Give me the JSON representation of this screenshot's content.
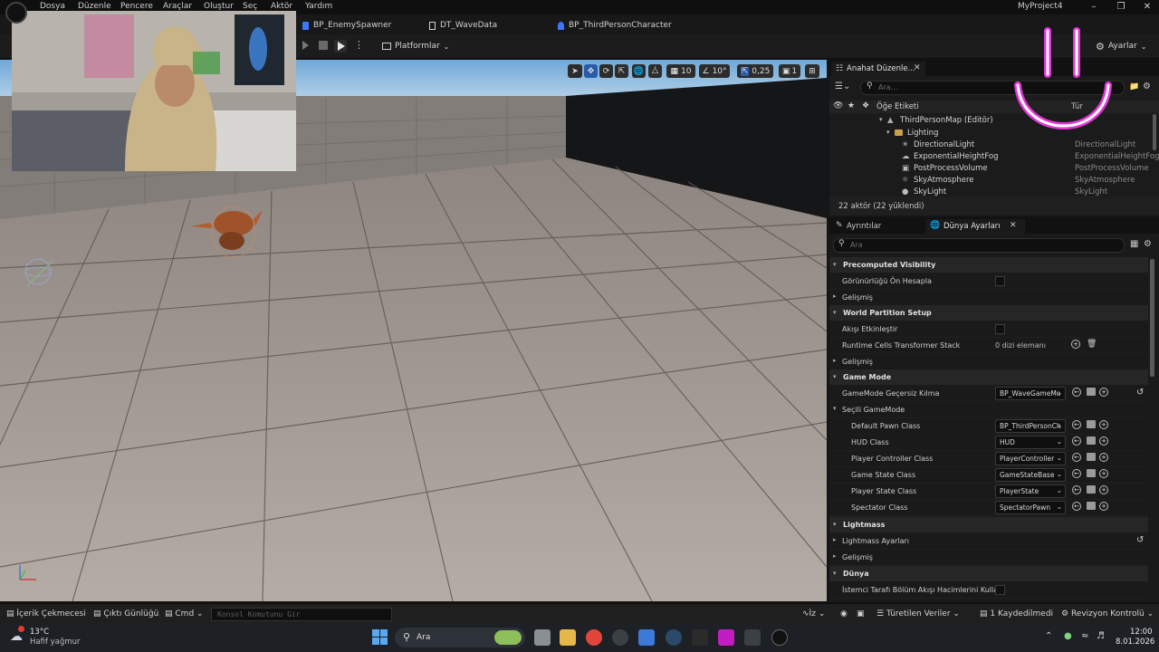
{
  "menu": {
    "items": [
      "Dosya",
      "Düzenle",
      "Pencere",
      "Araçlar",
      "Oluştur",
      "Seç",
      "Aktör",
      "Yardım"
    ],
    "project": "MyProject4"
  },
  "tabs": [
    {
      "label": "BP_EnemySpawner",
      "color": "#3b78ff"
    },
    {
      "label": "DT_WaveData",
      "color": "#d0d0d0"
    },
    {
      "label": "BP_ThirdPersonCharacter",
      "color": "#3b78ff"
    }
  ],
  "toolbar": {
    "platforms": "Platformlar",
    "settings": "Ayarlar"
  },
  "viewport": {
    "grid_snap": "10",
    "rot_snap": "10°",
    "scale_snap": "0,25",
    "camera_speed": "1"
  },
  "outliner": {
    "tab": "Anahat Düzenle...",
    "search_placeholder": "Ara...",
    "col_label": "Öğe Etiketi",
    "col_type": "Tür",
    "map": "ThirdPersonMap (Editör)",
    "folder": "Lighting",
    "items": [
      {
        "name": "DirectionalLight",
        "type": "DirectionalLight"
      },
      {
        "name": "ExponentialHeightFog",
        "type": "ExponentialHeightFog"
      },
      {
        "name": "PostProcessVolume",
        "type": "PostProcessVolume"
      },
      {
        "name": "SkyAtmosphere",
        "type": "SkyAtmosphere"
      },
      {
        "name": "SkyLight",
        "type": "SkyLight"
      }
    ],
    "status": "22 aktör (22 yüklendi)"
  },
  "details": {
    "tab_details": "Ayrıntılar",
    "tab_world": "Dünya Ayarları",
    "search_placeholder": "Ara",
    "sections": {
      "precomputed": "Precomputed Visibility",
      "precompute_vis": "Görünürlüğü Ön Hesapla",
      "advanced1": "Gelişmiş",
      "world_partition": "World Partition Setup",
      "enable_streaming": "Akışı Etkinleştir",
      "runtime_cells": "Runtime Cells Transformer Stack",
      "runtime_cells_value": "0 dizi elemanı",
      "advanced2": "Gelişmiş",
      "game_mode": "Game Mode",
      "gm_override": "GameMode Geçersiz Kılma",
      "gm_override_value": "BP_WaveGameMo",
      "selected_gm": "Seçili GameMode",
      "default_pawn": "Default Pawn Class",
      "default_pawn_value": "BP_ThirdPersonCh",
      "hud": "HUD Class",
      "hud_value": "HUD",
      "player_controller": "Player Controller Class",
      "player_controller_value": "PlayerController",
      "game_state": "Game State Class",
      "game_state_value": "GameStateBase",
      "player_state": "Player State Class",
      "player_state_value": "PlayerState",
      "spectator": "Spectator Class",
      "spectator_value": "SpectatorPawn",
      "lightmass": "Lightmass",
      "lightmass_settings": "Lightmass Ayarları",
      "advanced3": "Gelişmiş",
      "world": "Dünya",
      "client_side": "İstemci Tarafı Bölüm Akışı Hacimlerini Kullan"
    }
  },
  "statusbar": {
    "content_drawer": "İçerik Çekmecesi",
    "output_log": "Çıktı Günlüğü",
    "cmd": "Cmd",
    "console_placeholder": "Konsol Komutunu Gir",
    "iz": "İz",
    "derived_data": "Türetilen Veriler",
    "unsaved": "1 Kaydedilmedi",
    "revision": "Revizyon Kontrolü"
  },
  "taskbar": {
    "temp": "13°C",
    "weather": "Hafif yağmur",
    "search": "Ara",
    "time": "12:00",
    "date": "8.01.2026"
  }
}
